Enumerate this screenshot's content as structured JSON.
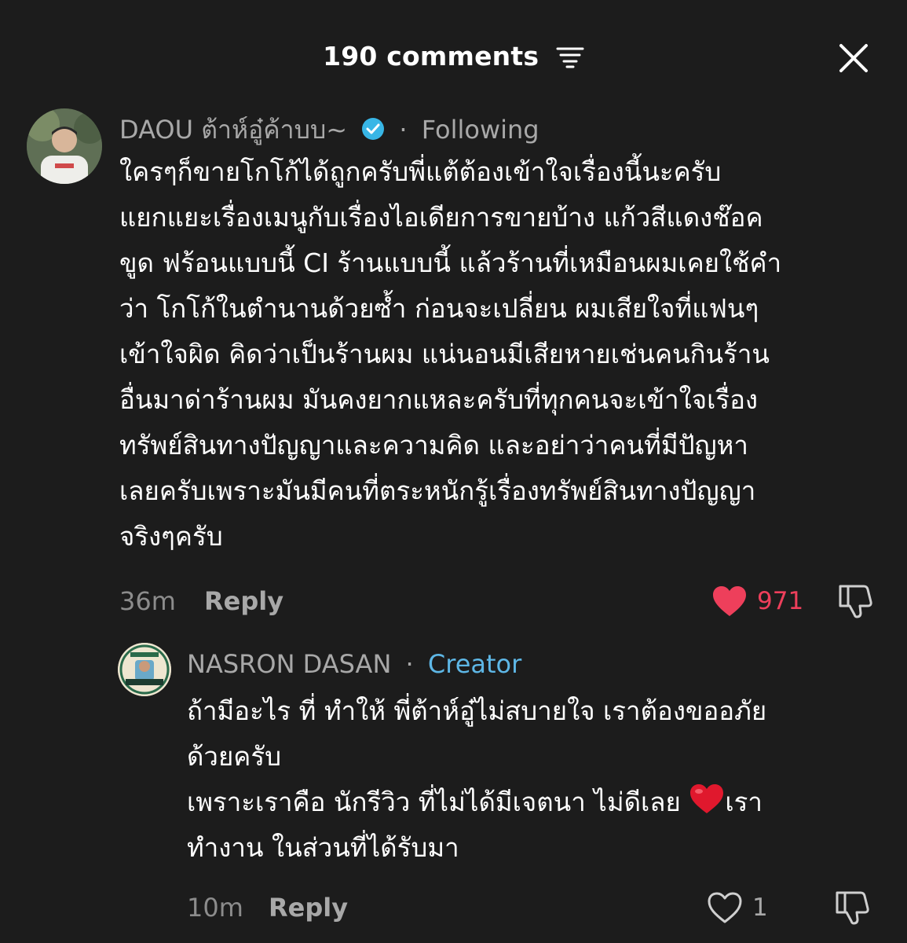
{
  "header": {
    "title": "190 comments",
    "filter_icon": "filter-lines-icon",
    "close_icon": "close-icon"
  },
  "comment": {
    "username": "DAOU ต้าห์อู๋ค้าบบ~",
    "separator": "·",
    "following_label": "Following",
    "verified_icon": "verified-badge-icon",
    "text_lines": [
      "ใครๆก็ขายโกโก้ได้ถูกครับพี่แต้ต้องเข้าใจเรื่องนี้นะครับ",
      "แยกแยะเรื่องเมนูกับเรื่องไอเดียการขายบ้าง แก้วสีแดงช๊อค",
      "ขูด ฟร้อนแบบนี้ CI ร้านแบบนี้ แล้วร้านที่เหมือนผมเคยใช้คำ",
      "ว่า โกโก้ในตำนานด้วยซ้ำ ก่อนจะเปลี่ยน ผมเสียใจที่แฟนๆ",
      "เข้าใจผิด คิดว่าเป็นร้านผม แน่นอนมีเสียหายเช่นคนกินร้าน",
      "อื่นมาด่าร้านผม มันคงยากแหละครับที่ทุกคนจะเข้าใจเรื่อง",
      "ทรัพย์สินทางปัญญาและความคิด และอย่าว่าคนที่มีปัญหา",
      "เลยครับเพราะมันมีคนที่ตระหนักรู้เรื่องทรัพย์สินทางปัญญา",
      "จริงๆครับ"
    ],
    "time": "36m",
    "reply_label": "Reply",
    "likes": "971",
    "liked": true,
    "heart_color": "#ee3f5b"
  },
  "reply": {
    "username": "NASRON DASAN",
    "separator": "·",
    "creator_label": "Creator",
    "creator_color": "#5eb7e6",
    "text_lines": [
      "ถ้ามีอะไร ที่ ทำให้ พี่ต้าห์อู๋ไม่สบายใจ เราต้องขออภัย",
      "ด้วยครับ"
    ],
    "text_line3_before": "เพราะเราคือ นักรีวิว ที่ไม่ได้มีเจตนา ไม่ดีเลย ",
    "text_line3_after": "เรา",
    "text_line4": "ทำงาน ในส่วนที่ได้รับมา",
    "time": "10m",
    "reply_label": "Reply",
    "likes": "1",
    "liked": false
  }
}
